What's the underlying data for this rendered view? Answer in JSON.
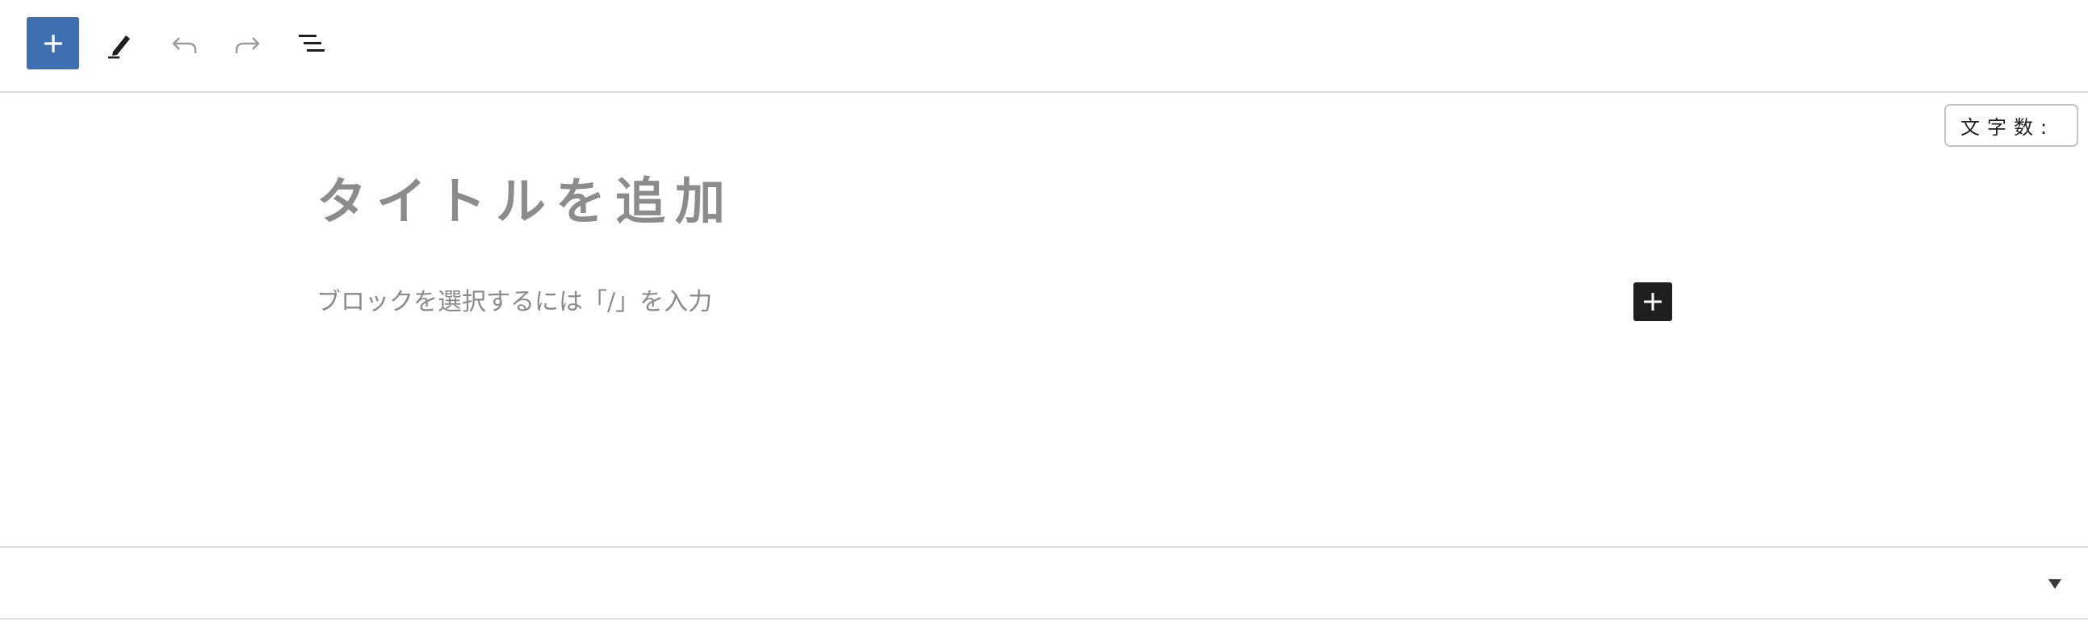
{
  "toolbar": {
    "inserter_icon": "plus-icon",
    "tools_icon": "pencil-icon",
    "undo_icon": "undo-icon",
    "redo_icon": "redo-icon",
    "outline_icon": "list-view-icon",
    "inserter_color": "#3e6fb0"
  },
  "char_count": {
    "label": "文字数:"
  },
  "editor": {
    "title_placeholder": "タイトルを追加",
    "block_placeholder": "ブロックを選択するには「/」を入力",
    "block_inserter_icon": "plus-icon"
  },
  "footer": {
    "toggle_icon": "caret-down-icon"
  }
}
